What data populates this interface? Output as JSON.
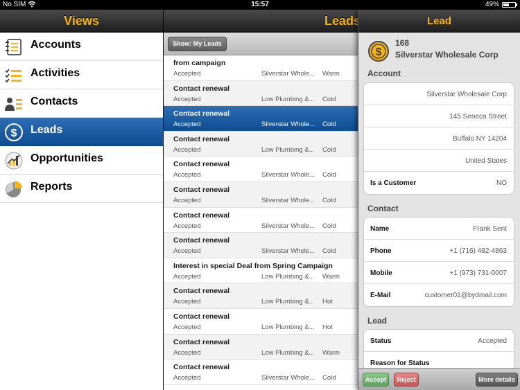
{
  "status_bar": {
    "carrier": "No SIM",
    "time": "15:57",
    "battery": "49%"
  },
  "views": {
    "title": "Views",
    "items": [
      {
        "label": "Accounts",
        "icon": "ledger-icon"
      },
      {
        "label": "Activities",
        "icon": "checklist-icon"
      },
      {
        "label": "Contacts",
        "icon": "contact-card-icon"
      },
      {
        "label": "Leads",
        "icon": "dollar-coin-icon",
        "selected": true
      },
      {
        "label": "Opportunities",
        "icon": "opportunity-chart-icon"
      },
      {
        "label": "Reports",
        "icon": "pie-chart-icon"
      }
    ]
  },
  "leads": {
    "title": "Leads",
    "filter_button": "Show: My Leads",
    "rows": [
      {
        "title": "from campaign",
        "status": "Accepted",
        "account": "Silverstar Whole...",
        "qualification": "Warm"
      },
      {
        "title": "Contact renewal",
        "status": "Accepted",
        "account": "Low Plumbing &...",
        "qualification": "Cold"
      },
      {
        "title": "Contact renewal",
        "status": "Accepted",
        "account": "Silverstar Whole...",
        "qualification": "Cold",
        "selected": true
      },
      {
        "title": "Contact renewal",
        "status": "Accepted",
        "account": "Low Plumbing &...",
        "qualification": "Cold"
      },
      {
        "title": "Contact renewal",
        "status": "Accepted",
        "account": "Silverstar Whole...",
        "qualification": "Cold"
      },
      {
        "title": "Contact renewal",
        "status": "Accepted",
        "account": "Silverstar Whole...",
        "qualification": "Cold"
      },
      {
        "title": "Contact renewal",
        "status": "Accepted",
        "account": "Silverstar Whole...",
        "qualification": "Cold"
      },
      {
        "title": "Contact renewal",
        "status": "Accepted",
        "account": "Silverstar Whole...",
        "qualification": "Cold"
      },
      {
        "title": "Interest in special Deal from Spring Campaign",
        "status": "Accepted",
        "account": "Low Plumbing &...",
        "qualification": "Warm"
      },
      {
        "title": "Contact renewal",
        "status": "Accepted",
        "account": "Low Plumbing &...",
        "qualification": "Hot"
      },
      {
        "title": "Contact renewal",
        "status": "Accepted",
        "account": "Low Plumbing &...",
        "qualification": "Hot"
      },
      {
        "title": "Contact renewal",
        "status": "Accepted",
        "account": "Low Plumbing &...",
        "qualification": "Warm"
      },
      {
        "title": "Contact renewal",
        "status": "Accepted",
        "account": "Silverstar Whole...",
        "qualification": "Cold"
      }
    ]
  },
  "detail": {
    "title": "Lead",
    "id": "168",
    "name": "Silverstar Wholesale Corp",
    "account_heading": "Account",
    "account": {
      "name": "Silverstar Wholesale Corp",
      "street": "145 Seneca Street",
      "city": "Buffalo NY  14204",
      "country": "United States",
      "customer_label": "Is a Customer",
      "customer_value": "NO"
    },
    "contact_heading": "Contact",
    "contact": [
      {
        "label": "Name",
        "value": "Frank Sent"
      },
      {
        "label": "Phone",
        "value": "+1 (716) 482-4863"
      },
      {
        "label": "Mobile",
        "value": "+1 (973) 731-0007"
      },
      {
        "label": "E-Mail",
        "value": "customer01@bydmail.com"
      }
    ],
    "lead_heading": "Lead",
    "lead": [
      {
        "label": "Status",
        "value": "Accepted"
      },
      {
        "label": "Reason for Status",
        "value": ""
      }
    ],
    "buttons": {
      "accept": "Accept",
      "reject": "Reject",
      "more": "More details"
    }
  },
  "colors": {
    "accent": "#f6b418",
    "selection": "#1a5aa0",
    "accept": "#6fb06f",
    "reject": "#d06a6a"
  }
}
